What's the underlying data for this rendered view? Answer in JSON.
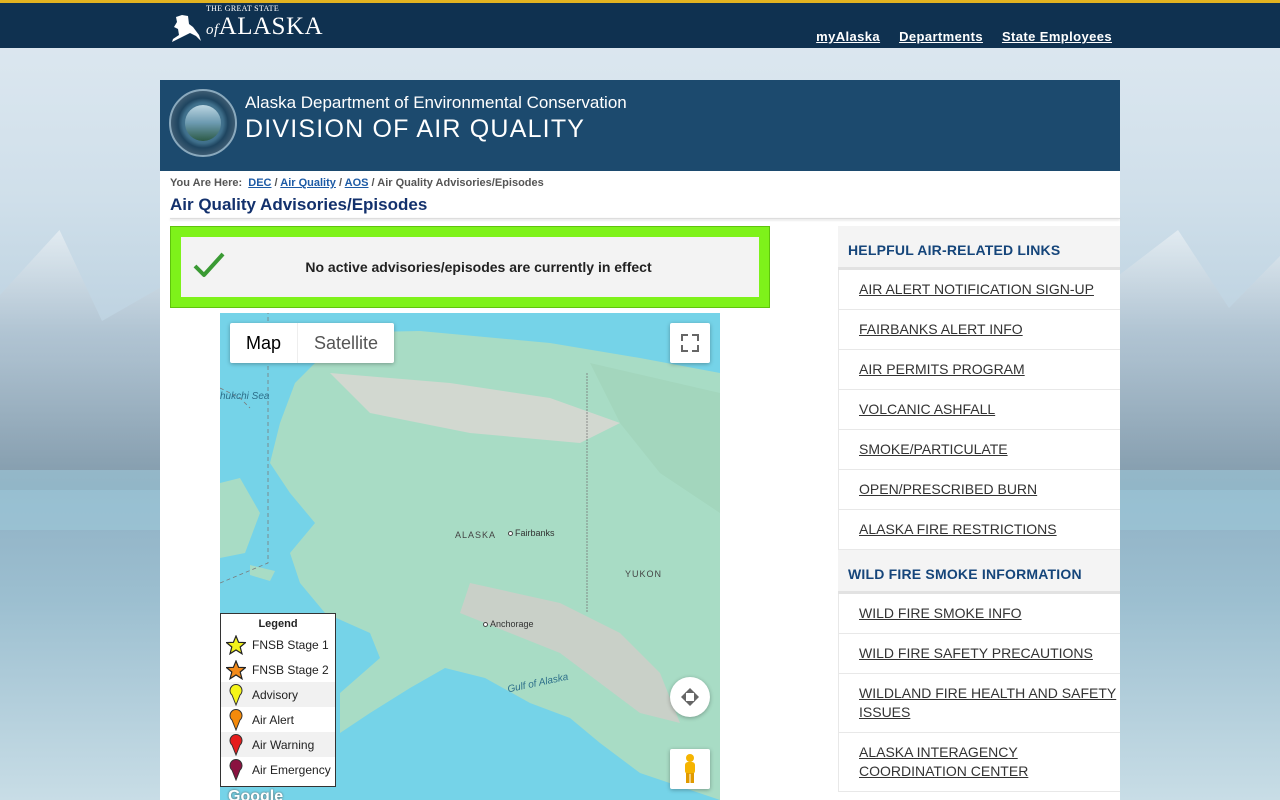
{
  "topbar": {
    "logo_small": "THE GREAT STATE",
    "logo_of": "of",
    "logo_big": "ALASKA",
    "nav": [
      "myAlaska",
      "Departments",
      "State Employees"
    ]
  },
  "banner": {
    "department": "Alaska Department of Environmental Conservation",
    "division": "DIVISION OF AIR QUALITY"
  },
  "breadcrumb": {
    "prefix": "You Are Here:",
    "links": [
      "DEC",
      "Air Quality",
      "AOS"
    ],
    "separator": " / ",
    "current": "Air Quality Advisories/Episodes"
  },
  "page_title": "Air Quality Advisories/Episodes",
  "advisory": {
    "message": "No active advisories/episodes are currently in effect",
    "border_color": "#7ef21a"
  },
  "map": {
    "type_buttons": [
      "Map",
      "Satellite"
    ],
    "selected_type": "Map",
    "labels": {
      "sea": "hukchi Sea",
      "alaska": "ALASKA",
      "fairbanks": "Fairbanks",
      "yukon": "YUKON",
      "anchorage": "Anchorage",
      "gulf": "Gulf of Alaska"
    },
    "google": "Google"
  },
  "legend": {
    "title": "Legend",
    "items": [
      {
        "label": "FNSB Stage 1",
        "icon": "star-icon",
        "color": "#f2f21a"
      },
      {
        "label": "FNSB Stage 2",
        "icon": "star-icon",
        "color": "#f28a1a"
      },
      {
        "label": "Advisory",
        "icon": "pin-icon",
        "color": "#f5f519"
      },
      {
        "label": "Air Alert",
        "icon": "pin-icon",
        "color": "#f58a0a"
      },
      {
        "label": "Air Warning",
        "icon": "pin-icon",
        "color": "#e51c1c"
      },
      {
        "label": "Air Emergency",
        "icon": "pin-icon",
        "color": "#8a1240"
      }
    ]
  },
  "sidebar": {
    "sections": [
      {
        "heading": "HELPFUL AIR-RELATED LINKS",
        "links": [
          "AIR ALERT NOTIFICATION SIGN-UP",
          "FAIRBANKS ALERT INFO",
          "AIR PERMITS PROGRAM",
          "VOLCANIC ASHFALL",
          "SMOKE/PARTICULATE",
          "OPEN/PRESCRIBED BURN",
          "ALASKA FIRE RESTRICTIONS"
        ]
      },
      {
        "heading": "WILD FIRE SMOKE INFORMATION",
        "links": [
          "WILD FIRE SMOKE INFO",
          "WILD FIRE SAFETY PRECAUTIONS",
          "WILDLAND FIRE HEALTH AND SAFETY ISSUES",
          "ALASKA INTERAGENCY COORDINATION CENTER"
        ]
      }
    ]
  },
  "colors": {
    "topbar": "#0f3150",
    "topbar_accent": "#e2b321",
    "banner": "#1c4a6e",
    "title": "#13316d",
    "sidebar_heading": "#15457a"
  }
}
